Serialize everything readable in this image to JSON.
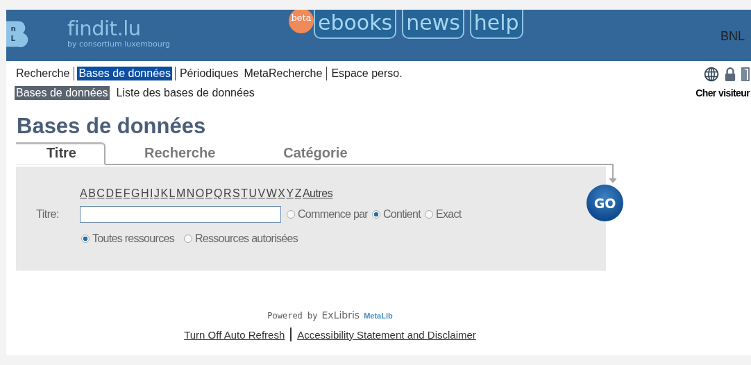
{
  "header": {
    "logo_letters": [
      "n",
      "L"
    ],
    "site_name": "findit.lu",
    "tagline": "by consortium luxembourg",
    "badge": "beta",
    "links": [
      {
        "label": "ebooks"
      },
      {
        "label": "news"
      },
      {
        "label": "help"
      }
    ],
    "institution": "BNL"
  },
  "nav": [
    {
      "label": "Recherche",
      "selected": false
    },
    {
      "label": "Bases de données",
      "selected": true
    },
    {
      "label": "Périodiques",
      "selected": false
    },
    {
      "label": "MetaRecherche",
      "selected": false
    },
    {
      "label": "Espace perso.",
      "selected": false
    }
  ],
  "subnav": [
    {
      "label": "Bases de données",
      "selected": true
    },
    {
      "label": "Liste des bases de données",
      "selected": false
    }
  ],
  "greeting": "Cher visiteur",
  "page_title": "Bases de données",
  "tabs": [
    {
      "label": "Titre",
      "selected": true
    },
    {
      "label": "Recherche",
      "selected": false
    },
    {
      "label": "Catégorie",
      "selected": false
    }
  ],
  "letters": [
    "A",
    "B",
    "C",
    "D",
    "E",
    "F",
    "G",
    "H",
    "I",
    "J",
    "K",
    "L",
    "M",
    "N",
    "O",
    "P",
    "Q",
    "R",
    "S",
    "T",
    "U",
    "V",
    "W",
    "X",
    "Y",
    "Z",
    "Autres"
  ],
  "title_field": {
    "label": "Titre:"
  },
  "match_options": [
    {
      "label": "Commence par",
      "selected": false
    },
    {
      "label": "Contient",
      "selected": true
    },
    {
      "label": "Exact",
      "selected": false
    }
  ],
  "resource_options": [
    {
      "label": "Toutes ressources",
      "selected": true
    },
    {
      "label": "Ressources autorisées",
      "selected": false
    }
  ],
  "go_button": "GO",
  "footer": {
    "powered_by": "Powered by",
    "brand": "ExLibris",
    "product": "MetaLib",
    "links": [
      "Turn Off Auto Refresh",
      "Accessibility Statement and Disclaimer"
    ]
  }
}
